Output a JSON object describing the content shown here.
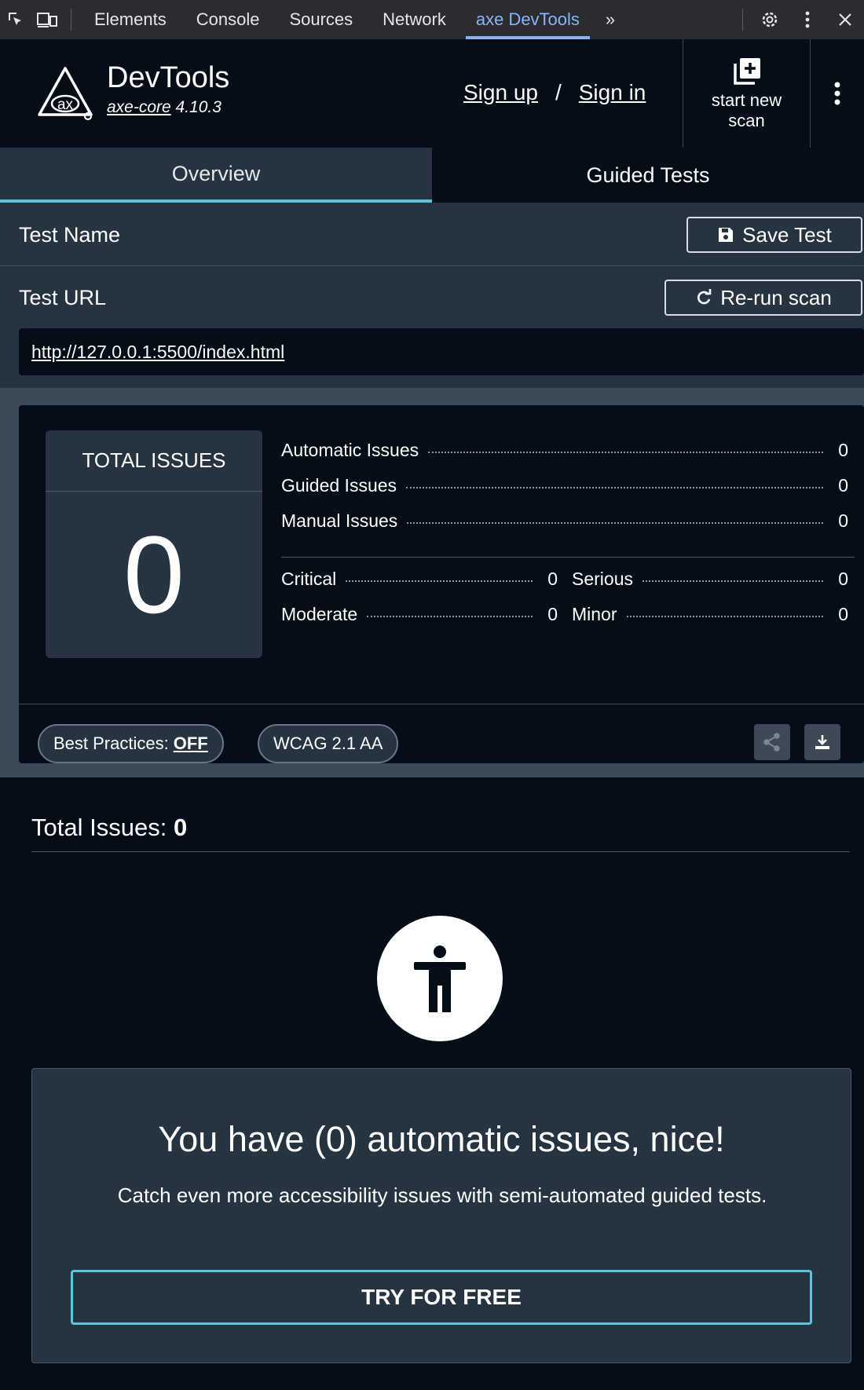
{
  "devtools_tabs": {
    "items": [
      "Elements",
      "Console",
      "Sources",
      "Network",
      "axe DevTools"
    ],
    "active": "axe DevTools",
    "overflow": "»"
  },
  "header": {
    "brand_title": "DevTools",
    "engine_name": "axe-core",
    "engine_version": "4.10.3",
    "sign_up": "Sign up",
    "separator": "/",
    "sign_in": "Sign in",
    "start_scan_line1": "start new",
    "start_scan_line2": "scan"
  },
  "tabs": {
    "overview": "Overview",
    "guided": "Guided Tests"
  },
  "test": {
    "name_label": "Test Name",
    "save_label": "Save Test",
    "url_label": "Test URL",
    "rerun_label": "Re-run scan",
    "url": "http://127.0.0.1:5500/index.html"
  },
  "summary": {
    "total_label": "TOTAL ISSUES",
    "total_value": "0",
    "automatic_label": "Automatic Issues",
    "automatic_value": "0",
    "guided_label": "Guided Issues",
    "guided_value": "0",
    "manual_label": "Manual Issues",
    "manual_value": "0",
    "critical_label": "Critical",
    "critical_value": "0",
    "serious_label": "Serious",
    "serious_value": "0",
    "moderate_label": "Moderate",
    "moderate_value": "0",
    "minor_label": "Minor",
    "minor_value": "0",
    "best_practices_label": "Best Practices:",
    "best_practices_value": "OFF",
    "standard_label": "WCAG 2.1 AA"
  },
  "results": {
    "title_prefix": "Total Issues:",
    "title_value": "0"
  },
  "cta": {
    "title": "You have (0) automatic issues, nice!",
    "text": "Catch even more accessibility issues with semi-automated guided tests.",
    "button": "TRY FOR FREE"
  },
  "colors": {
    "background": "#050e18",
    "panel": "#263441",
    "accent": "#5ec4de",
    "devtools_active": "#8ab4f8"
  }
}
